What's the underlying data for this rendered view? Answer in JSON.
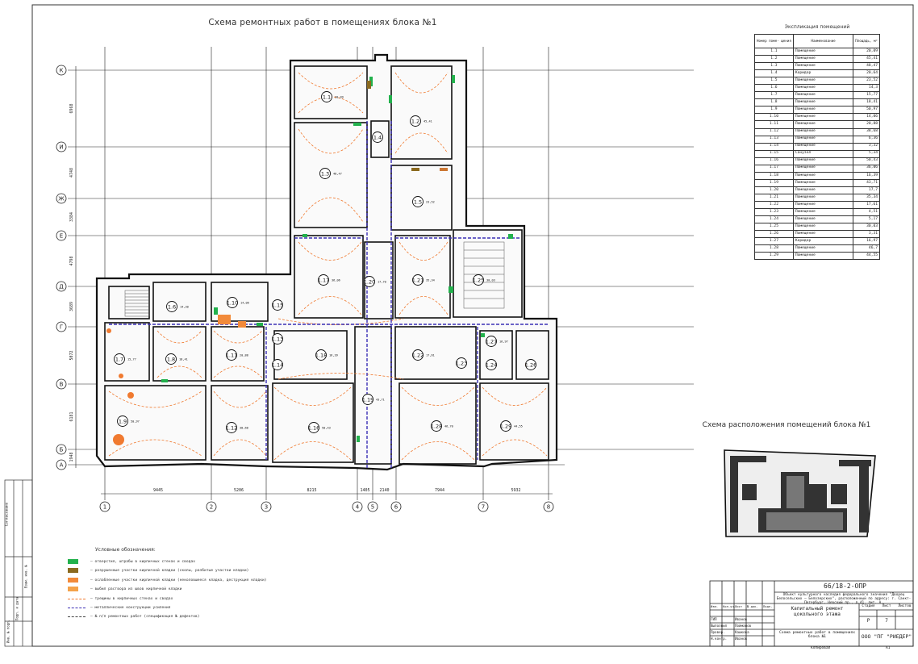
{
  "plan_title": "Схема ремонтных работ в помещениях блока №1",
  "explication": {
    "title": "Экспликация помещений",
    "headers": [
      "Номер поме- щения",
      "Наименование",
      "Площадь, м²"
    ],
    "rows": [
      [
        "1.1",
        "Помещение",
        "20,09"
      ],
      [
        "1.2",
        "Помещение",
        "45,41"
      ],
      [
        "1.3",
        "Помещение",
        "48,47"
      ],
      [
        "1.4",
        "Коридор",
        "20,64"
      ],
      [
        "1.5",
        "Помещение",
        "23,52"
      ],
      [
        "1.6",
        "Помещение",
        "14,3"
      ],
      [
        "1.7",
        "Помещение",
        "15,77"
      ],
      [
        "1.8",
        "Помещение",
        "18,41"
      ],
      [
        "1.9",
        "Помещение",
        "50,97"
      ],
      [
        "1.10",
        "Помещение",
        "14,06"
      ],
      [
        "1.11",
        "Помещение",
        "20,88"
      ],
      [
        "1.12",
        "Помещение",
        "38,68"
      ],
      [
        "1.13",
        "Помещение",
        "6,36"
      ],
      [
        "1.14",
        "Помещение",
        "3,32"
      ],
      [
        "1.15",
        "Санузел",
        "5,34"
      ],
      [
        "1.16",
        "Помещение",
        "50,43"
      ],
      [
        "1.17",
        "Помещение",
        "36,06"
      ],
      [
        "1.18",
        "Помещение",
        "16,39"
      ],
      [
        "1.19",
        "Помещение",
        "43,71"
      ],
      [
        "1.20",
        "Помещение",
        "17,7"
      ],
      [
        "1.21",
        "Помещение",
        "35,34"
      ],
      [
        "1.22",
        "Помещение",
        "17,61"
      ],
      [
        "1.23",
        "Помещение",
        "4,51"
      ],
      [
        "1.24",
        "Помещение",
        "5,17"
      ],
      [
        "1.25",
        "Помещение",
        "30,03"
      ],
      [
        "1.26",
        "Помещение",
        "3,31"
      ],
      [
        "1.27",
        "Коридор",
        "16,97"
      ],
      [
        "1.28",
        "Помещение",
        "46,7"
      ],
      [
        "1.29",
        "Помещение",
        "44,55"
      ]
    ]
  },
  "location_title": "Схема расположения помещений блока №1",
  "legend": {
    "title": "Условные обозначения:",
    "items": [
      {
        "color": "#22b14c",
        "text": "– отверстия, штрабы в кирпичных стенах и сводах"
      },
      {
        "color": "#8b6a1f",
        "text": "– разрушенные участки кирпичной кладки (сколы, разбитые участки кладки)"
      },
      {
        "color": "#f28a3a",
        "text": "– ослабленные участки кирпичной кладки (неколовшееся кладка, деструкция кладки)"
      },
      {
        "color": "#f4a24a",
        "text": "– выбил раствора из швов кирпичной кладки"
      },
      {
        "color": "#f07a30",
        "text": "– трещины в кирпичных стенах и сводах"
      },
      {
        "color": "#3b2fb5",
        "text": "– металлические конструкции усиления"
      },
      {
        "color": "#444444",
        "text": "– № п/п ремонтных работ (спецификация № дефектов)"
      }
    ]
  },
  "axes": {
    "rows": [
      "К",
      "И",
      "Ж",
      "Е",
      "Д",
      "Г",
      "В",
      "Б",
      "А"
    ],
    "cols": [
      "1",
      "2",
      "3",
      "4",
      "5",
      "6",
      "7",
      "8"
    ],
    "col_dims": [
      "9445",
      "5206",
      "8215",
      "1405",
      "2140",
      "7944",
      "5932"
    ],
    "row_dims": [
      "6968",
      "4748",
      "3384",
      "4798",
      "3689",
      "5072",
      "6181",
      "1948"
    ]
  },
  "rooms": [
    {
      "id": "1.1",
      "area": "20,09"
    },
    {
      "id": "1.2",
      "area": "45,41"
    },
    {
      "id": "1.3",
      "area": "48,47"
    },
    {
      "id": "1.4",
      "area": ""
    },
    {
      "id": "1.5",
      "area": "23,52"
    },
    {
      "id": "1.6",
      "area": "14,30"
    },
    {
      "id": "1.7",
      "area": "15,77"
    },
    {
      "id": "1.8",
      "area": "18,41"
    },
    {
      "id": "1.9",
      "area": "50,97"
    },
    {
      "id": "1.10",
      "area": "14,06"
    },
    {
      "id": "1.11",
      "area": "20,88"
    },
    {
      "id": "1.12",
      "area": "38,68"
    },
    {
      "id": "1.13",
      "area": ""
    },
    {
      "id": "1.14",
      "area": ""
    },
    {
      "id": "1.15",
      "area": ""
    },
    {
      "id": "1.16",
      "area": "50,43"
    },
    {
      "id": "1.17",
      "area": "36,06"
    },
    {
      "id": "1.18",
      "area": "16,39"
    },
    {
      "id": "1.19",
      "area": "43,71"
    },
    {
      "id": "1.20",
      "area": "17,70"
    },
    {
      "id": "1.21",
      "area": "35,34"
    },
    {
      "id": "1.22",
      "area": "17,61"
    },
    {
      "id": "1.23",
      "area": ""
    },
    {
      "id": "1.24",
      "area": ""
    },
    {
      "id": "1.25",
      "area": "30,03"
    },
    {
      "id": "1.26",
      "area": ""
    },
    {
      "id": "1.27",
      "area": "16,97"
    },
    {
      "id": "1.28",
      "area": "46,70"
    },
    {
      "id": "1.29",
      "area": "44,55"
    }
  ],
  "title_block": {
    "code": "66/18-2-ОПР",
    "object": "Объект культурного наследия федерального значения \"Дворец Белосельских – Белозерских\", расположенный по адресу: г. Санкт-Петербург, Невский пр., д.41, лит. А.",
    "work": "Капитальный ремонт цокольного этажа",
    "stage_header": "Стадия",
    "sheet_header": "Лист",
    "sheets_header": "Листов",
    "stage": "Р",
    "sheet": "7",
    "sheets": "",
    "drawing": "Схема ремонтных работ в помещениях блока №1",
    "company": "ООО \"ПГ \"РИЕДЕР\"",
    "copied": "Копировал",
    "format": "А1",
    "cols": [
      "Изм.",
      "Кол.уч.",
      "Лист",
      "№ док.",
      "Подп.",
      "Дата"
    ],
    "people": [
      [
        "ГИП",
        "Иванов"
      ],
      [
        "Выполнил",
        "Пойманов"
      ],
      [
        "Провер.",
        "Кашкова"
      ],
      [
        "Н.контр.",
        "Иванов"
      ]
    ]
  },
  "side_stamp": {
    "agreed": "Согласовано",
    "inv": "Инв. № подл.",
    "sign": "Подп. и дата",
    "replace": "Взам. инв. №"
  }
}
